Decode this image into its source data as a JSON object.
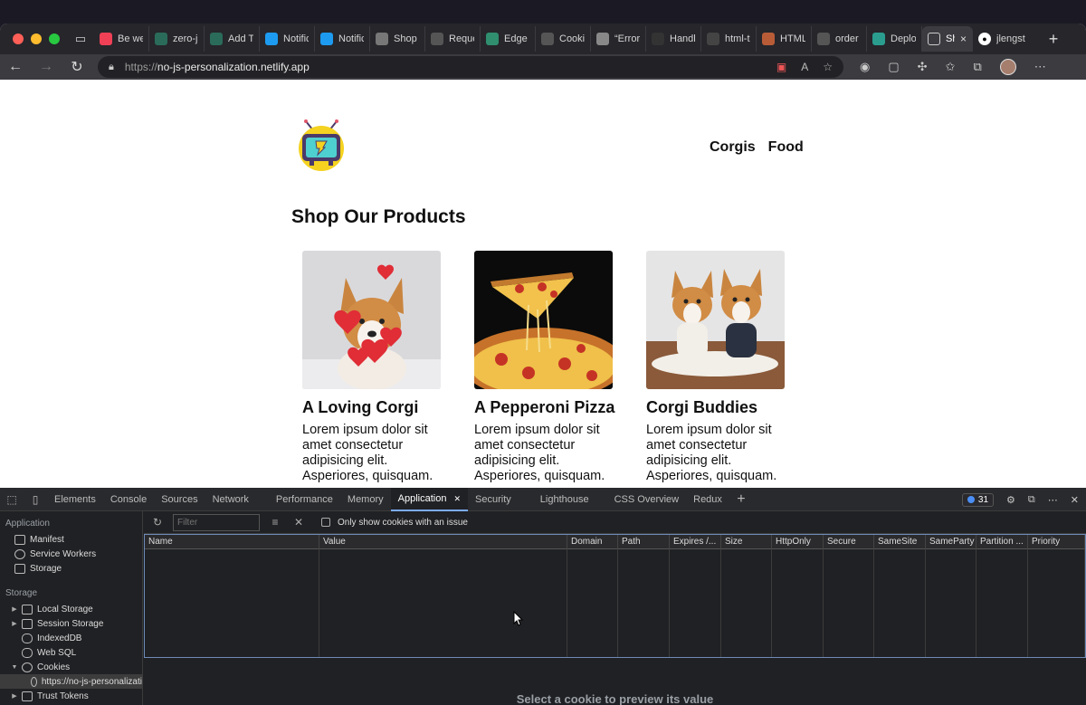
{
  "browser": {
    "tabs": [
      {
        "label": "Be wel",
        "icon": "pocket-icon",
        "color": "#ef4056"
      },
      {
        "label": "zero-js",
        "icon": "clock-icon",
        "color": "#2b6b5a"
      },
      {
        "label": "Add Ta",
        "icon": "shield-icon",
        "color": "#2b6b5a"
      },
      {
        "label": "Notific",
        "icon": "twitter-icon",
        "color": "#1d9bf0"
      },
      {
        "label": "Notific",
        "icon": "twitter-icon",
        "color": "#1d9bf0"
      },
      {
        "label": "Shop O",
        "icon": "page-icon",
        "color": "#777777"
      },
      {
        "label": "Reque",
        "icon": "mdn-icon",
        "color": "#555555"
      },
      {
        "label": "Edge F",
        "icon": "edge-icon",
        "color": "#2f8f6f"
      },
      {
        "label": "Cookie",
        "icon": "mdn-icon",
        "color": "#555555"
      },
      {
        "label": "“Error:",
        "icon": "google-icon",
        "color": "#888888"
      },
      {
        "label": "Handlin",
        "icon": "medium-icon",
        "color": "#333333"
      },
      {
        "label": "html-tr",
        "icon": "github-icon",
        "color": "#444444"
      },
      {
        "label": "HTML",
        "icon": "cloud-icon",
        "color": "#b85c38"
      },
      {
        "label": "order",
        "icon": "mdn-icon",
        "color": "#555555"
      },
      {
        "label": "Deploy",
        "icon": "netlify-icon",
        "color": "#2a9d8f"
      }
    ],
    "active_tab": {
      "label": "Sh",
      "close": "×"
    },
    "after_tab": {
      "label": "jlengst",
      "icon": "github-icon"
    },
    "url_proto": "https://",
    "url_host": "no-js-personalization.netlify.app"
  },
  "page": {
    "nav": [
      "Corgis",
      "Food"
    ],
    "heading": "Shop Our Products",
    "products": [
      {
        "title": "A Loving Corgi",
        "desc": "Lorem ipsum dolor sit amet consectetur adipisicing elit. Asperiores, quisquam."
      },
      {
        "title": "A Pepperoni Pizza",
        "desc": "Lorem ipsum dolor sit amet consectetur adipisicing elit. Asperiores, quisquam."
      },
      {
        "title": "Corgi Buddies",
        "desc": "Lorem ipsum dolor sit amet consectetur adipisicing elit. Asperiores, quisquam."
      }
    ]
  },
  "devtools": {
    "tabs": [
      "Elements",
      "Console",
      "Sources",
      "Network",
      "Performance",
      "Memory",
      "Application",
      "Security",
      "Lighthouse",
      "CSS Overview",
      "Redux"
    ],
    "active_tab": "Application",
    "issues_count": "31",
    "sidebar": {
      "application_title": "Application",
      "application_items": [
        "Manifest",
        "Service Workers",
        "Storage"
      ],
      "storage_title": "Storage",
      "storage_items": [
        "Local Storage",
        "Session Storage",
        "IndexedDB",
        "Web SQL",
        "Cookies"
      ],
      "cookie_origin": "https://no-js-personalizati",
      "trust_tokens": "Trust Tokens"
    },
    "filter_placeholder": "Filter",
    "only_issues_label": "Only show cookies with an issue",
    "columns": [
      "Name",
      "Value",
      "Domain",
      "Path",
      "Expires /...",
      "Size",
      "HttpOnly",
      "Secure",
      "SameSite",
      "SameParty",
      "Partition ...",
      "Priority"
    ],
    "preview_text": "Select a cookie to preview its value"
  }
}
